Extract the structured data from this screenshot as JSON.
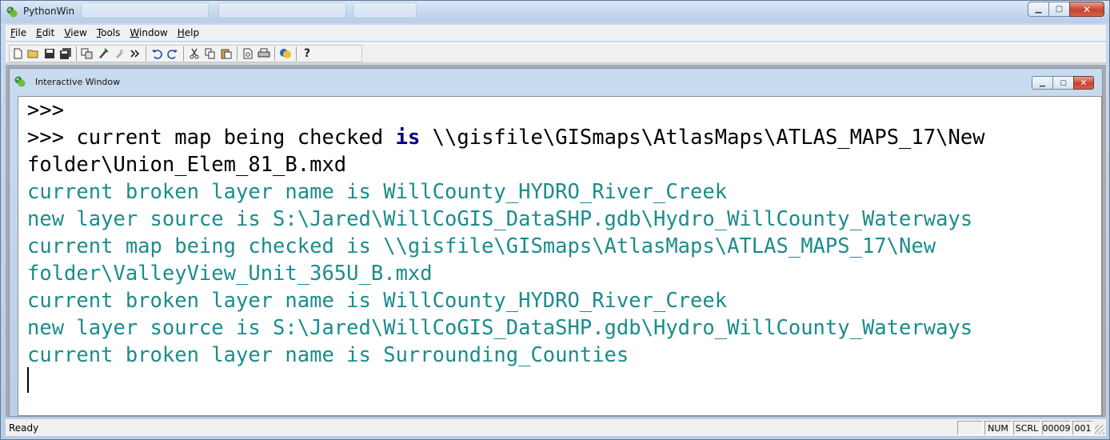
{
  "window": {
    "title": "PythonWin",
    "controls": {
      "minimize": "▁",
      "maximize": "▢",
      "close": "✕"
    }
  },
  "menu": {
    "items": [
      {
        "accel": "F",
        "rest": "ile"
      },
      {
        "accel": "E",
        "rest": "dit"
      },
      {
        "accel": "V",
        "rest": "iew"
      },
      {
        "accel": "T",
        "rest": "ools"
      },
      {
        "accel": "W",
        "rest": "indow"
      },
      {
        "accel": "H",
        "rest": "elp"
      }
    ]
  },
  "toolbar": {
    "icons": [
      "new-file-icon",
      "open-folder-icon",
      "save-icon",
      "save-all-icon",
      "locate-icon",
      "run-icon",
      "import-icon",
      "more-icon",
      "undo-icon",
      "redo-icon",
      "cut-icon",
      "copy-icon",
      "paste-icon",
      "print-preview-icon",
      "print-icon",
      "python-icon",
      "help-icon"
    ]
  },
  "interactive": {
    "title": "Interactive Window",
    "controls": {
      "minimize": "▁",
      "maximize": "▢",
      "close": "✕"
    },
    "lines": [
      {
        "prompt": ">>>",
        "pre": "",
        "kw": "",
        "post": "",
        "out": ""
      },
      {
        "prompt": ">>> ",
        "pre": "current map being checked ",
        "kw": "is",
        "post": " \\\\gisfile\\GISmaps\\AtlasMaps\\ATLAS_MAPS_17\\New",
        "out": ""
      },
      {
        "prompt": "",
        "pre": "folder\\Union_Elem_81_B.mxd",
        "kw": "",
        "post": "",
        "out": ""
      },
      {
        "prompt": "",
        "pre": "",
        "kw": "",
        "post": "",
        "out": "current broken layer name is WillCounty_HYDRO_River_Creek"
      },
      {
        "prompt": "",
        "pre": "",
        "kw": "",
        "post": "",
        "out": "new layer source is S:\\Jared\\WillCoGIS_DataSHP.gdb\\Hydro_WillCounty_Waterways"
      },
      {
        "prompt": "",
        "pre": "",
        "kw": "",
        "post": "",
        "out": "current map being checked is \\\\gisfile\\GISmaps\\AtlasMaps\\ATLAS_MAPS_17\\New"
      },
      {
        "prompt": "",
        "pre": "",
        "kw": "",
        "post": "",
        "out": "folder\\ValleyView_Unit_365U_B.mxd"
      },
      {
        "prompt": "",
        "pre": "",
        "kw": "",
        "post": "",
        "out": "current broken layer name is WillCounty_HYDRO_River_Creek"
      },
      {
        "prompt": "",
        "pre": "",
        "kw": "",
        "post": "",
        "out": "new layer source is S:\\Jared\\WillCoGIS_DataSHP.gdb\\Hydro_WillCounty_Waterways"
      },
      {
        "prompt": "",
        "pre": "",
        "kw": "",
        "post": "",
        "out": "current broken layer name is Surrounding_Counties"
      }
    ]
  },
  "status": {
    "text": "Ready",
    "indicators": [
      "",
      "NUM",
      "SCRL",
      "00009",
      "001"
    ]
  },
  "colors": {
    "output": "#1b8c8c",
    "keyword": "#00007f",
    "prompt": "#000000"
  }
}
